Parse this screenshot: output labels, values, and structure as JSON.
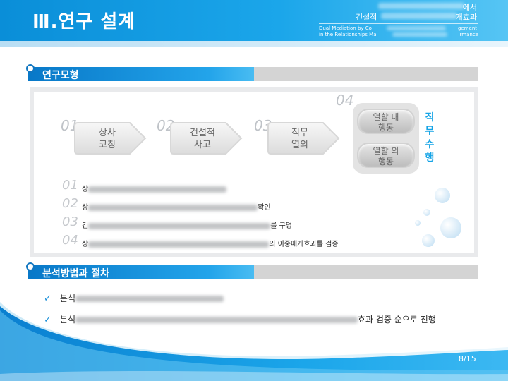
{
  "header": {
    "title": "Ⅲ.연구 설계",
    "subtitle_line1_end": "에서",
    "subtitle_line2_start": "건설적",
    "subtitle_line2_end": "개효과",
    "en_line1_start": "Dual Mediation by Co",
    "en_line1_end": "gement",
    "en_line2_start": "in the Relationships Ma",
    "en_line2_end": "rmance"
  },
  "sections": {
    "model": "연구모형",
    "method": "분석방법과 절차"
  },
  "model": {
    "steps": [
      {
        "num": "01",
        "line1": "상사",
        "line2": "코칭"
      },
      {
        "num": "02",
        "line1": "건설적",
        "line2": "사고"
      },
      {
        "num": "03",
        "line1": "직무",
        "line2": "열의"
      }
    ],
    "step4_num": "04",
    "pills": [
      {
        "line1": "열할 내",
        "line2": "행동"
      },
      {
        "line1": "열할 의",
        "line2": "행동"
      }
    ],
    "vertical_label": [
      "직",
      "무",
      "수",
      "행"
    ]
  },
  "hypotheses": [
    {
      "num": "01",
      "start": "상",
      "end": ""
    },
    {
      "num": "02",
      "start": "상",
      "end": "확인"
    },
    {
      "num": "03",
      "start": "건",
      "end": "를 구명"
    },
    {
      "num": "04",
      "start": "상",
      "end": "의 이중매개효과를 검증"
    }
  ],
  "method_items": [
    {
      "start": "분석",
      "end": ""
    },
    {
      "start": "분석",
      "end": "효과 검증 순으로 진행"
    }
  ],
  "page": {
    "label": "8/15"
  },
  "colors": {
    "accent": "#1ba6ea",
    "dark_accent": "#0878c8",
    "bar_grey": "#d4d4d4"
  }
}
